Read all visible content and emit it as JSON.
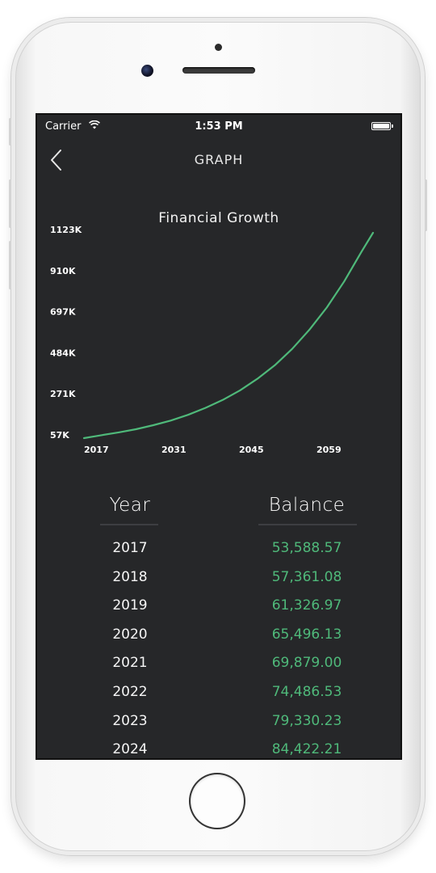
{
  "status": {
    "carrier": "Carrier",
    "time": "1:53 PM",
    "battery_icon": "battery-icon",
    "wifi_icon": "wifi-icon"
  },
  "nav": {
    "title": "GRAPH",
    "back_icon": "chevron-left-icon"
  },
  "colors": {
    "screen_bg": "#262729",
    "accent_green": "#4fb97a",
    "text": "#ffffff"
  },
  "chart_data": {
    "type": "line",
    "title": "Financial Growth",
    "xlabel": "",
    "ylabel": "",
    "x_ticks": [
      "2017",
      "2031",
      "2045",
      "2059"
    ],
    "y_ticks": [
      "1123K",
      "910K",
      "697K",
      "484K",
      "271K",
      "57K"
    ],
    "ylim": [
      57,
      1123
    ],
    "xlim": [
      2017,
      2067
    ],
    "grid": false,
    "series": [
      {
        "color": "#4fb97a",
        "x": [
          2017,
          2020,
          2023,
          2026,
          2029,
          2032,
          2035,
          2038,
          2041,
          2044,
          2047,
          2050,
          2053,
          2056,
          2059,
          2062,
          2065,
          2067
        ],
        "values": [
          57,
          72,
          87,
          103,
          124,
          148,
          178,
          214,
          255,
          305,
          365,
          435,
          520,
          620,
          735,
          870,
          1025,
          1123
        ]
      }
    ]
  },
  "table": {
    "headers": {
      "year": "Year",
      "balance": "Balance"
    },
    "rows": [
      {
        "year": "2017",
        "balance": "53,588.57"
      },
      {
        "year": "2018",
        "balance": "57,361.08"
      },
      {
        "year": "2019",
        "balance": "61,326.97"
      },
      {
        "year": "2020",
        "balance": "65,496.13"
      },
      {
        "year": "2021",
        "balance": "69,879.00"
      },
      {
        "year": "2022",
        "balance": "74,486.53"
      },
      {
        "year": "2023",
        "balance": "79,330.23"
      },
      {
        "year": "2024",
        "balance": "84,422.21"
      }
    ]
  }
}
